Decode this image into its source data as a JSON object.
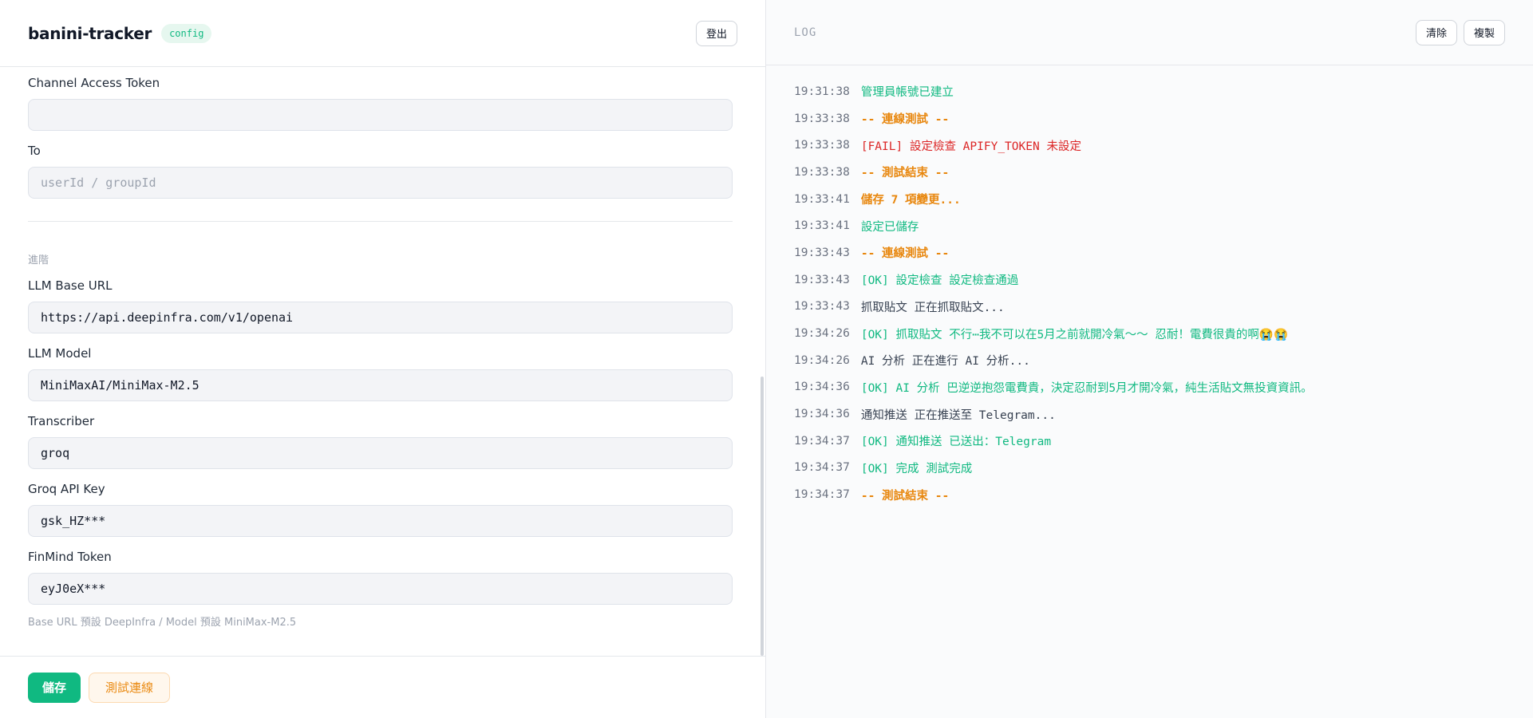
{
  "header": {
    "brand": "banini-tracker",
    "badge": "config",
    "logout": "登出"
  },
  "form": {
    "channel_token": {
      "label": "Channel Access Token",
      "value": "",
      "placeholder": ""
    },
    "to": {
      "label": "To",
      "value": "",
      "placeholder": "userId / groupId"
    },
    "section_advanced": "進階",
    "llm_base_url": {
      "label": "LLM Base URL",
      "value": "https://api.deepinfra.com/v1/openai"
    },
    "llm_model": {
      "label": "LLM Model",
      "value": "MiniMaxAI/MiniMax-M2.5"
    },
    "transcriber": {
      "label": "Transcriber",
      "value": "groq"
    },
    "groq_key": {
      "label": "Groq API Key",
      "value": "gsk_HZ***"
    },
    "finmind": {
      "label": "FinMind Token",
      "value": "eyJ0eX***"
    },
    "hint": "Base URL 預設 DeepInfra / Model 預設 MiniMax-M2.5"
  },
  "footer": {
    "save": "儲存",
    "test": "測試連線"
  },
  "log": {
    "title": "LOG",
    "clear": "清除",
    "copy": "複製",
    "lines": [
      {
        "ts": "19:31:38",
        "msg": "管理員帳號已建立",
        "kind": "ok"
      },
      {
        "ts": "19:33:38",
        "msg": "-- 連線測試 --",
        "kind": "warn"
      },
      {
        "ts": "19:33:38",
        "msg": "[FAIL] 設定檢查 APIFY_TOKEN 未設定",
        "kind": "fail"
      },
      {
        "ts": "19:33:38",
        "msg": "-- 測試結束 --",
        "kind": "warn"
      },
      {
        "ts": "19:33:41",
        "msg": "儲存 7 項變更...",
        "kind": "warn"
      },
      {
        "ts": "19:33:41",
        "msg": "設定已儲存",
        "kind": "ok"
      },
      {
        "ts": "19:33:43",
        "msg": "-- 連線測試 --",
        "kind": "warn"
      },
      {
        "ts": "19:33:43",
        "msg": "[OK] 設定檢查 設定檢查通過",
        "kind": "ok"
      },
      {
        "ts": "19:33:43",
        "msg": "抓取貼文 正在抓取貼文...",
        "kind": "info"
      },
      {
        "ts": "19:34:26",
        "msg": "[OK] 抓取貼文 不行⋯我不可以在5月之前就開冷氣〜〜 忍耐！電費很貴的啊😭😭",
        "kind": "ok"
      },
      {
        "ts": "19:34:26",
        "msg": "AI 分析 正在進行 AI 分析...",
        "kind": "info"
      },
      {
        "ts": "19:34:36",
        "msg": "[OK] AI 分析 巴逆逆抱怨電費貴，決定忍耐到5月才開冷氣，純生活貼文無投資資訊。",
        "kind": "ok"
      },
      {
        "ts": "19:34:36",
        "msg": "通知推送 正在推送至 Telegram...",
        "kind": "info"
      },
      {
        "ts": "19:34:37",
        "msg": "[OK] 通知推送 已送出：Telegram",
        "kind": "ok"
      },
      {
        "ts": "19:34:37",
        "msg": "[OK] 完成 測試完成",
        "kind": "ok"
      },
      {
        "ts": "19:34:37",
        "msg": "-- 測試結束 --",
        "kind": "warn"
      }
    ]
  }
}
